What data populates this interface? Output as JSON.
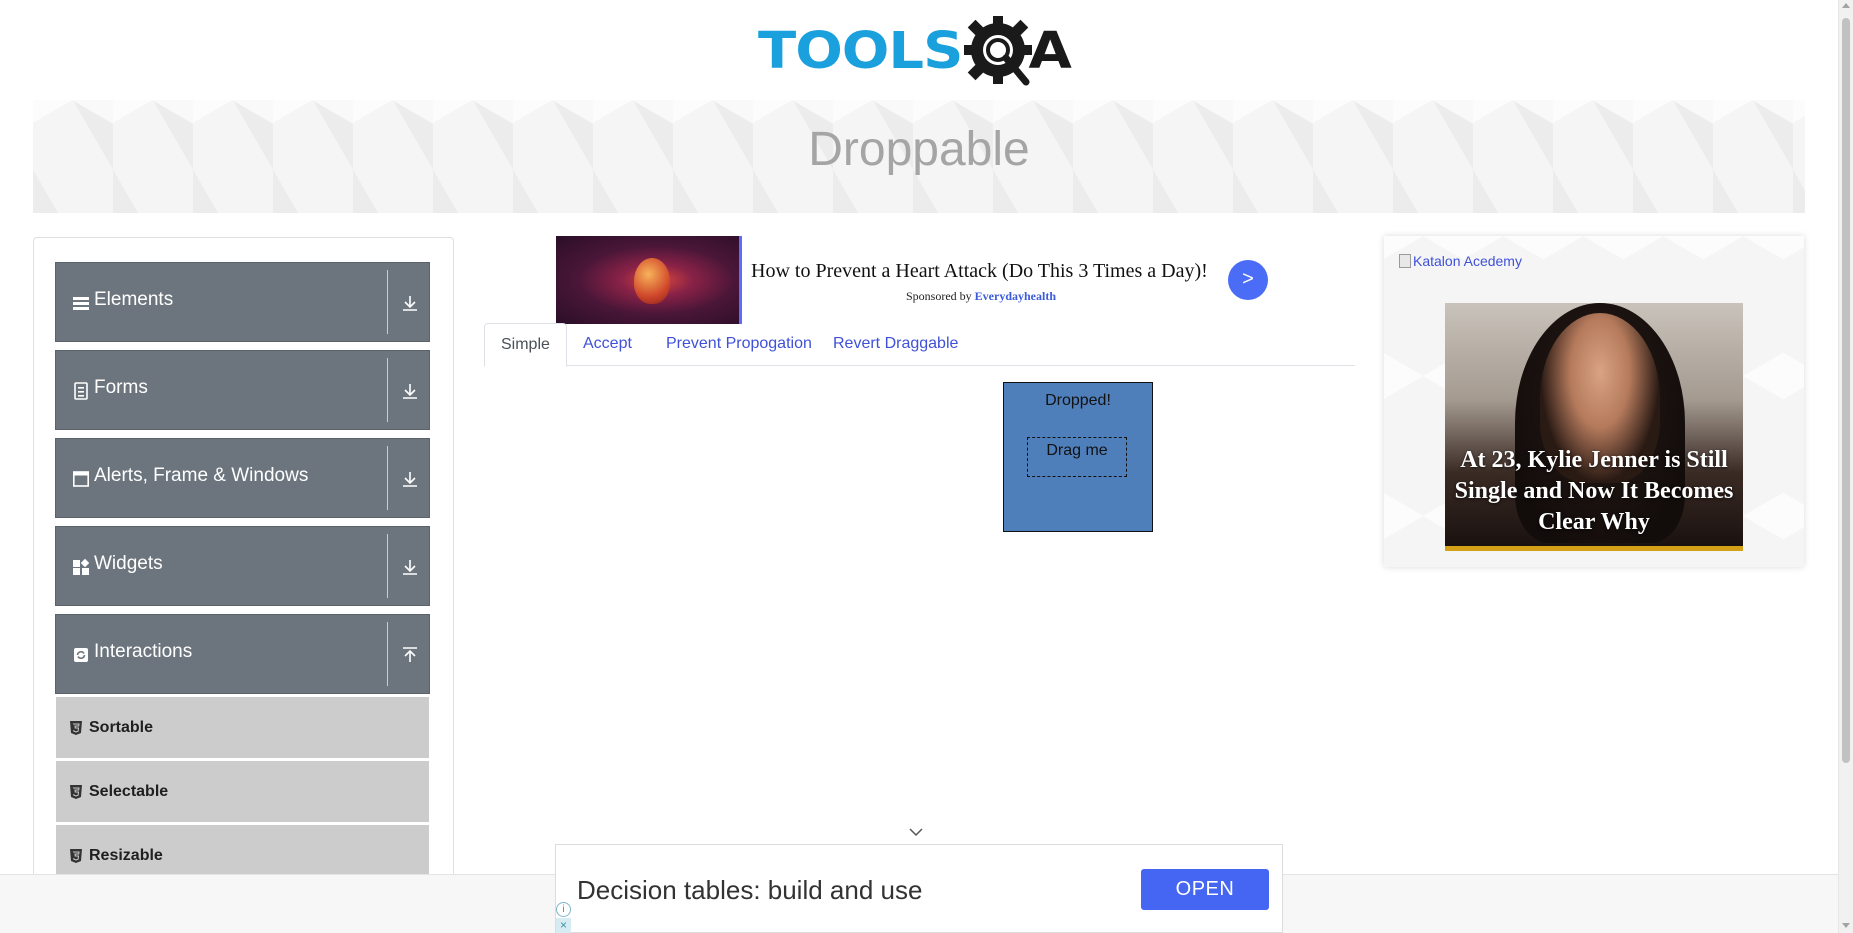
{
  "logo": {
    "text_main": "TOOLS",
    "text_tail": "A"
  },
  "banner": {
    "title": "Droppable"
  },
  "sidebar": {
    "groups": [
      {
        "label": "Elements",
        "icon": "list-icon",
        "arrow": "download-arrow-icon"
      },
      {
        "label": "Forms",
        "icon": "form-icon",
        "arrow": "download-arrow-icon"
      },
      {
        "label": "Alerts, Frame & Windows",
        "icon": "window-icon",
        "arrow": "download-arrow-icon"
      },
      {
        "label": "Widgets",
        "icon": "widgets-icon",
        "arrow": "download-arrow-icon"
      },
      {
        "label": "Interactions",
        "icon": "refresh-icon",
        "arrow": "upload-arrow-icon"
      }
    ],
    "items": [
      {
        "label": "Sortable",
        "icon": "html5-icon"
      },
      {
        "label": "Selectable",
        "icon": "html5-icon"
      },
      {
        "label": "Resizable",
        "icon": "html5-icon"
      }
    ]
  },
  "ad_top": {
    "headline": "How to Prevent a Heart Attack (Do This 3 Times a Day)!",
    "sponsor_prefix": "Sponsored by",
    "sponsor_name": "Everydayhealth",
    "next_label": ">"
  },
  "tabs": [
    {
      "label": "Simple",
      "active": true
    },
    {
      "label": "Accept",
      "active": false
    },
    {
      "label": "Prevent Propogation",
      "active": false
    },
    {
      "label": "Revert Draggable",
      "active": false
    }
  ],
  "droppable": {
    "drop_label": "Dropped!",
    "drag_label": "Drag me"
  },
  "ad_right": {
    "broken_image_alt": "Katalon Acedemy",
    "promo_text": "At 23, Kylie Jenner is Still Single and Now It Becomes Clear Why"
  },
  "ad_bottom": {
    "text": "Decision tables: build and use",
    "cta": "OPEN",
    "info": "i",
    "close": "×"
  },
  "colors": {
    "logo_blue": "#1aa0dc",
    "sidebar_group": "#6c757d",
    "sidebar_item": "#cccccc",
    "tab_link": "#3f51d8",
    "drop_box": "#4f7fbb",
    "cta_blue": "#4466f2"
  }
}
